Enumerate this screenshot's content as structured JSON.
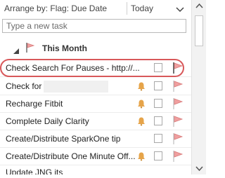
{
  "header": {
    "arrange_label": "Arrange by: Flag: Due Date",
    "today_label": "Today"
  },
  "new_task": {
    "placeholder": "Type a new task"
  },
  "group": {
    "label": "This Month"
  },
  "tasks": [
    {
      "title": "Check Search For Pauses - http://...",
      "has_reminder": false,
      "highlighted": true
    },
    {
      "title": "Check for",
      "has_reminder": true
    },
    {
      "title": "Recharge Fitbit",
      "has_reminder": true
    },
    {
      "title": "Complete Daily Clarity",
      "has_reminder": true
    },
    {
      "title": "Create/Distribute SparkOne tip",
      "has_reminder": false
    },
    {
      "title": "Create/Distribute One Minute Off...",
      "has_reminder": true
    },
    {
      "title": "Update JNG its",
      "has_reminder": false
    }
  ],
  "colors": {
    "flag": "#f0a0a0",
    "flag_outline": "#d97b7b",
    "highlight_ring": "#d8585a",
    "bell": "#e6a44a"
  },
  "icons": [
    "sort-arrow-icon",
    "expand-toggle-icon",
    "flag-icon",
    "bell-icon",
    "scroll-up-icon",
    "scroll-down-icon"
  ]
}
